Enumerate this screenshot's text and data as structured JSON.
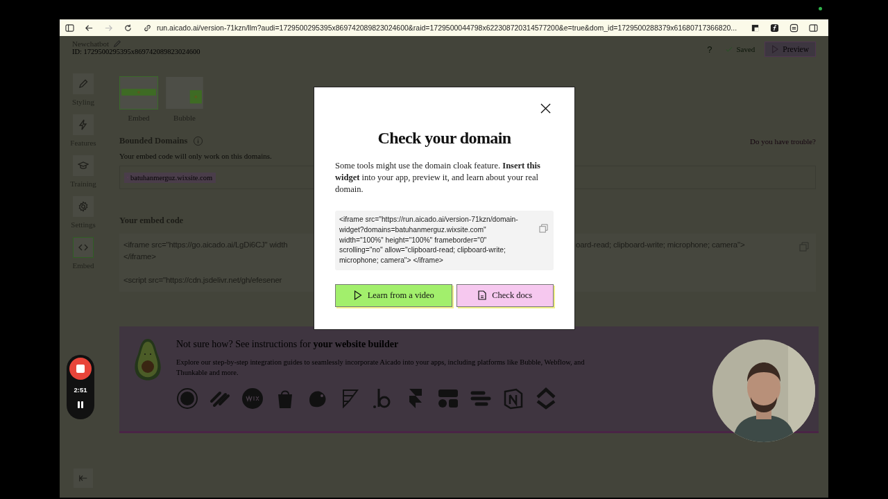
{
  "browser": {
    "url": "run.aicado.ai/version-71kzn/llm?audi=1729500295395x869742089823024600&raid=1729500044798x622308720314577200&e=true&dom_id=1729500288379x61680717366820..."
  },
  "app": {
    "name": "Newchatbot",
    "id": "ID: 1729500295395x869742089823024600",
    "help": "?",
    "saved": "Saved",
    "preview": "Preview"
  },
  "sidebar": {
    "items": [
      {
        "label": "Styling",
        "selected": false
      },
      {
        "label": "Features",
        "selected": false
      },
      {
        "label": "Training",
        "selected": false
      },
      {
        "label": "Settings",
        "selected": false
      },
      {
        "label": "Embed",
        "selected": true
      }
    ]
  },
  "layout_options": [
    {
      "label": "Embed",
      "selected": true
    },
    {
      "label": "Bubble",
      "selected": false
    }
  ],
  "bounded_domains": {
    "heading": "Bounded Domains",
    "description": "Your embed code will only work on this domains.",
    "tags": [
      "batuhanmerguz.wixsite.com"
    ],
    "help_link": "Do you have trouble?"
  },
  "embed_code": {
    "heading": "Your embed code",
    "left_fragments": [
      "<iframe src=\"https://go.aicado.ai/LgDi6CJ\" width",
      "</iframe>",
      "<script src=\"https://cdn.jsdelivr.net/gh/efesener"
    ],
    "right_fragments": [
      "oard-read; clipboard-write; microphone; camera\">"
    ]
  },
  "dialog": {
    "title": "Check your domain",
    "text": "Some tools might use the domain cloak feature. **Insert this widget** into your app, preview it, and learn about your real domain.",
    "code": "<iframe src=\"https://run.aicado.ai/version-71kzn/domain-widget?domains=batuhanmerguz.wixsite.com\" width=\"100%\" height=\"100%\" frameborder=\"0\" scrolling=\"no\" allow=\"clipboard-read; clipboard-write; microphone; camera\"> </iframe>",
    "buttons": [
      {
        "label": "Learn from a video",
        "kind": "video"
      },
      {
        "label": "Check docs",
        "kind": "docs"
      }
    ]
  },
  "guide_banner": {
    "title": "Not sure how? See instructions for **your website builder**",
    "text": "Explore our step-by-step integration guides to seamlessly incorporate Aicado into your apps, including platforms like Bubble, Webflow, and Thunkable and more."
  },
  "recorder": {
    "time": "2:51"
  }
}
